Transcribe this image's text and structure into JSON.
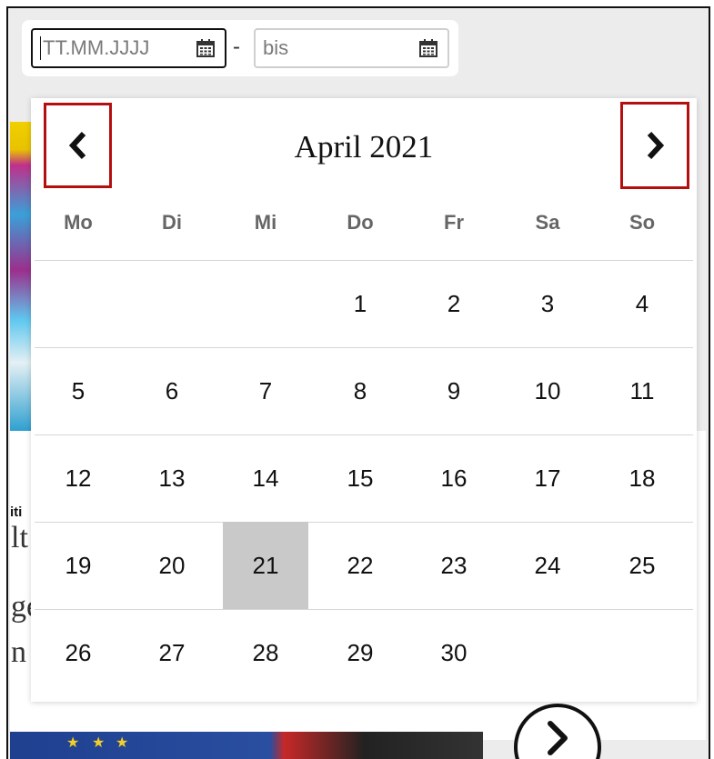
{
  "date_range": {
    "from_placeholder": "TT.MM.JJJJ",
    "separator": "-",
    "to_placeholder": "bis"
  },
  "calendar": {
    "month_title": "April 2021",
    "weekdays": [
      "Mo",
      "Di",
      "Mi",
      "Do",
      "Fr",
      "Sa",
      "So"
    ],
    "weeks": [
      [
        "",
        "",
        "",
        "1",
        "2",
        "3",
        "4"
      ],
      [
        "5",
        "6",
        "7",
        "8",
        "9",
        "10",
        "11"
      ],
      [
        "12",
        "13",
        "14",
        "15",
        "16",
        "17",
        "18"
      ],
      [
        "19",
        "20",
        "21",
        "22",
        "23",
        "24",
        "25"
      ],
      [
        "26",
        "27",
        "28",
        "29",
        "30",
        "",
        ""
      ]
    ],
    "highlighted_day": "21",
    "highlight_color": "#c9c9c9",
    "nav_button_border_color": "#b40f0f",
    "prev_icon": "chevron-left-icon",
    "next_icon": "chevron-right-icon"
  },
  "background": {
    "bold_fragment": "iti",
    "serif_fragments": [
      "lt",
      "ge",
      "n"
    ]
  }
}
